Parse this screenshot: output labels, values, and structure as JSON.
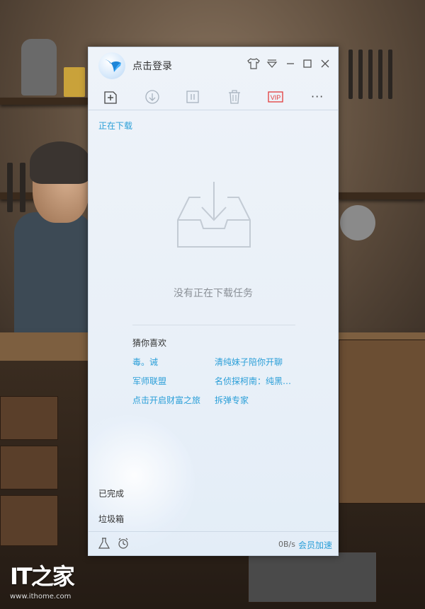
{
  "window": {
    "login_text": "点击登录",
    "toolbar": {
      "new_task": "new-task",
      "start": "start",
      "pause": "pause",
      "delete": "delete",
      "vip_label": "VIP",
      "more": "···"
    },
    "tabs": {
      "downloading": "正在下载",
      "completed": "已完成",
      "trash": "垃圾箱"
    },
    "empty_message": "没有正在下载任务",
    "recommend": {
      "title": "猜你喜欢",
      "items": [
        "毒。诫",
        "清纯妹子陪你开聊",
        "军师联盟",
        "名侦探柯南：纯黑…",
        "点击开启财富之旅",
        "拆弹专家"
      ]
    },
    "footer": {
      "speed": "0B/s",
      "vip_speed": "会员加速"
    },
    "colors": {
      "accent": "#2b9fd8",
      "vip_red": "#e23b3b"
    }
  },
  "watermark": {
    "logo": "IT之家",
    "url": "www.ithome.com"
  }
}
